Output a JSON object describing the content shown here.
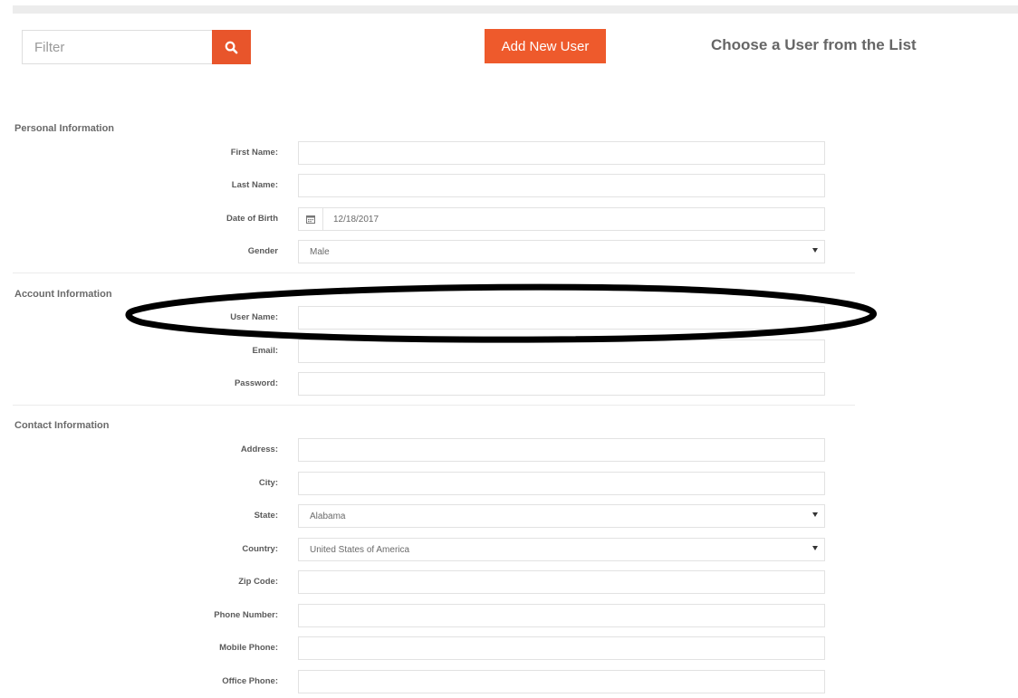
{
  "toolbar": {
    "filter_placeholder": "Filter",
    "search_icon": "search-icon",
    "add_button_label": "Add New User",
    "choose_title": "Choose a User from the List"
  },
  "sections": {
    "personal": "Personal Information",
    "account": "Account Information",
    "contact": "Contact Information"
  },
  "fields": {
    "first_name": {
      "label": "First Name:",
      "value": ""
    },
    "last_name": {
      "label": "Last Name:",
      "value": ""
    },
    "dob": {
      "label": "Date of Birth",
      "value": "12/18/2017",
      "icon": "calendar-icon"
    },
    "gender": {
      "label": "Gender",
      "value": "Male"
    },
    "username": {
      "label": "User Name:",
      "value": ""
    },
    "email": {
      "label": "Email:",
      "value": ""
    },
    "password": {
      "label": "Password:",
      "value": ""
    },
    "address": {
      "label": "Address:",
      "value": ""
    },
    "city": {
      "label": "City:",
      "value": ""
    },
    "state": {
      "label": "State:",
      "value": "Alabama"
    },
    "country": {
      "label": "Country:",
      "value": "United States of America"
    },
    "zip": {
      "label": "Zip Code:",
      "value": ""
    },
    "phone": {
      "label": "Phone Number:",
      "value": ""
    },
    "mobile": {
      "label": "Mobile Phone:",
      "value": ""
    },
    "office": {
      "label": "Office Phone:",
      "value": ""
    }
  },
  "colors": {
    "accent": "#ee5a2c",
    "annotation": "#000000"
  }
}
